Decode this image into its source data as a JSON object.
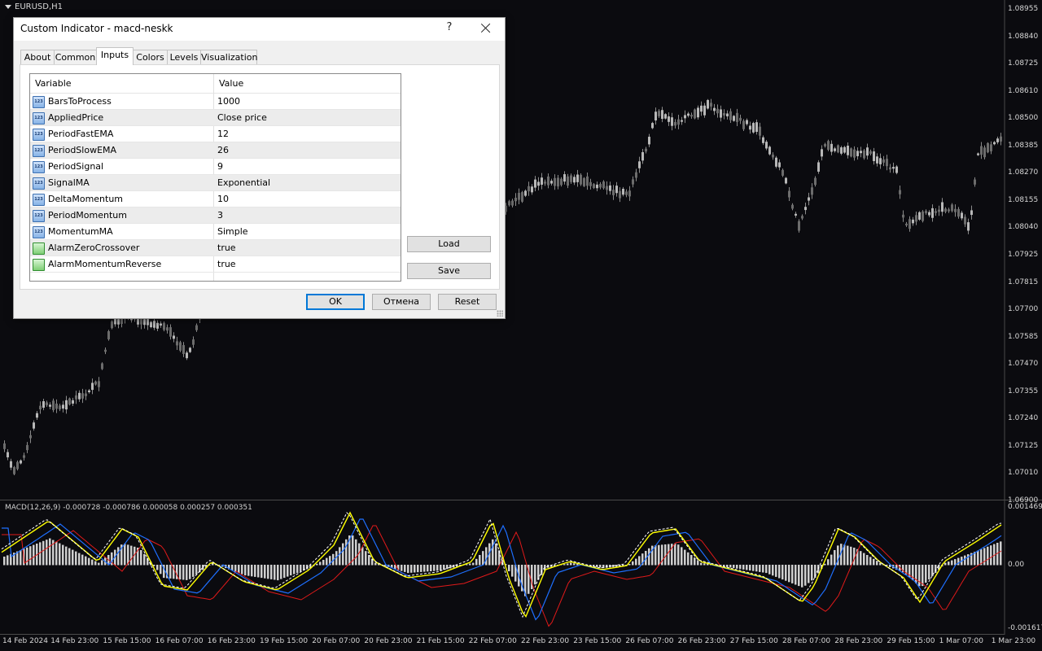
{
  "chart": {
    "symbol_title": "EURUSD,H1",
    "indicator_title": "MACD(12,26,9) -0.000728 -0.000786 0.000058 0.000257 0.000351",
    "price_labels": [
      "1.08955",
      "1.08840",
      "1.08725",
      "1.08610",
      "1.08500",
      "1.08385",
      "1.08270",
      "1.08155",
      "1.08040",
      "1.07925",
      "1.07815",
      "1.07700",
      "1.07585",
      "1.07470",
      "1.07355",
      "1.07240",
      "1.07125",
      "1.07010",
      "1.06900"
    ],
    "indicator_labels": [
      "0.001469",
      "0.00",
      "-0.001617"
    ],
    "time_labels": [
      "14 Feb 2024",
      "14 Feb 23:00",
      "15 Feb 15:00",
      "16 Feb 07:00",
      "16 Feb 23:00",
      "19 Feb 15:00",
      "20 Feb 07:00",
      "20 Feb 23:00",
      "21 Feb 15:00",
      "22 Feb 07:00",
      "22 Feb 23:00",
      "23 Feb 15:00",
      "26 Feb 07:00",
      "26 Feb 23:00",
      "27 Feb 15:00",
      "28 Feb 07:00",
      "28 Feb 23:00",
      "29 Feb 15:00",
      "1 Mar 07:00",
      "1 Mar 23:00"
    ],
    "colors": {
      "background": "#0b0b0f",
      "candle": "#8a8a8a",
      "histogram": "#cfcfcf",
      "macd_line": "#ffff00",
      "signal_dashed": "#ffffff",
      "line_blue": "#1e6fff",
      "line_red": "#e01a1a"
    }
  },
  "dialog": {
    "title": "Custom Indicator - macd-neskk",
    "help_label": "?",
    "close_icon": "close-icon",
    "tabs": [
      {
        "label": "About",
        "active": false
      },
      {
        "label": "Common",
        "active": false
      },
      {
        "label": "Inputs",
        "active": true
      },
      {
        "label": "Colors",
        "active": false
      },
      {
        "label": "Levels",
        "active": false
      },
      {
        "label": "Visualization",
        "active": false
      }
    ],
    "grid": {
      "col_variable": "Variable",
      "col_value": "Value",
      "icon_numeric": "123",
      "rows": [
        {
          "variable": "BarsToProcess",
          "value": "1000",
          "kind": "numeric"
        },
        {
          "variable": "AppliedPrice",
          "value": "Close price",
          "kind": "numeric"
        },
        {
          "variable": "PeriodFastEMA",
          "value": "12",
          "kind": "numeric"
        },
        {
          "variable": "PeriodSlowEMA",
          "value": "26",
          "kind": "numeric"
        },
        {
          "variable": "PeriodSignal",
          "value": "9",
          "kind": "numeric"
        },
        {
          "variable": "SignalMA",
          "value": "Exponential",
          "kind": "numeric"
        },
        {
          "variable": "DeltaMomentum",
          "value": "10",
          "kind": "numeric"
        },
        {
          "variable": "PeriodMomentum",
          "value": "3",
          "kind": "numeric"
        },
        {
          "variable": "MomentumMA",
          "value": "Simple",
          "kind": "numeric"
        },
        {
          "variable": "AlarmZeroCrossover",
          "value": "true",
          "kind": "bool"
        },
        {
          "variable": "AlarmMomentumReverse",
          "value": "true",
          "kind": "bool"
        }
      ]
    },
    "buttons": {
      "load": "Load",
      "save": "Save",
      "ok": "OK",
      "cancel": "Отмена",
      "reset": "Reset"
    }
  }
}
